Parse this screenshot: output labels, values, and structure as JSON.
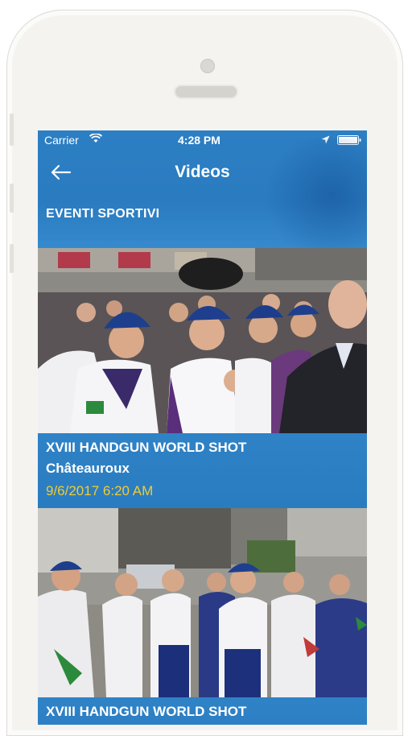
{
  "status_bar": {
    "carrier": "Carrier",
    "time": "4:28 PM"
  },
  "nav": {
    "title": "Videos",
    "back_icon": "arrow-left-icon"
  },
  "section": {
    "label": "EVENTI SPORTIVI"
  },
  "videos": [
    {
      "title": "XVIII HANDGUN WORLD SHOT",
      "subtitle": "Châteauroux",
      "date": "9/6/2017 6:20 AM"
    },
    {
      "title": "XVIII HANDGUN WORLD SHOT"
    }
  ],
  "colors": {
    "header_blue": "#2d7fc4",
    "date_yellow": "#f2cc30",
    "phone_frame": "#f4f3ef"
  }
}
